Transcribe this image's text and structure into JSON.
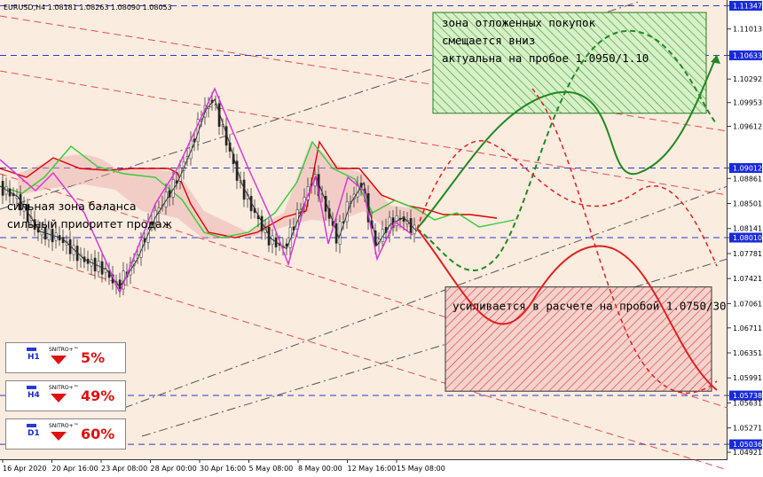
{
  "chart_data": {
    "type": "line",
    "title": "EURUSD,H4 1.08181 1.08263 1.08090 1.08053",
    "xlabel": "",
    "ylabel": "",
    "ylim": [
      1.0482,
      1.1143
    ],
    "grid": false,
    "x_ticks": [
      "16 Apr 2020",
      "20 Apr 16:00",
      "23 Apr 08:00",
      "28 Apr 00:00",
      "30 Apr 16:00",
      "5 May 08:00",
      "8 May 00:00",
      "12 May 16:00",
      "15 May 08:00"
    ],
    "y_ticks": [
      "1.11347",
      "1.11013",
      "1.10633",
      "1.10292",
      "1.09953",
      "1.09612",
      "1.09012",
      "1.08861",
      "1.08501",
      "1.08141",
      "1.08010",
      "1.07781",
      "1.07421",
      "1.07061",
      "1.06711",
      "1.06351",
      "1.05991",
      "1.05738",
      "1.05631",
      "1.05271",
      "1.05036",
      "1.04921"
    ],
    "highlighted_levels": [
      "1.11347",
      "1.10633",
      "1.09012",
      "1.08010",
      "1.05738",
      "1.05036"
    ],
    "price_path": [
      [
        0,
        1.0875
      ],
      [
        20,
        1.086
      ],
      [
        45,
        1.081
      ],
      [
        70,
        1.08
      ],
      [
        95,
        1.077
      ],
      [
        120,
        1.0755
      ],
      [
        135,
        1.073
      ],
      [
        155,
        1.077
      ],
      [
        175,
        1.083
      ],
      [
        200,
        1.088
      ],
      [
        220,
        1.094
      ],
      [
        232,
        1.0985
      ],
      [
        242,
        1.1
      ],
      [
        258,
        1.094
      ],
      [
        272,
        1.088
      ],
      [
        288,
        1.084
      ],
      [
        305,
        1.08
      ],
      [
        323,
        1.0785
      ],
      [
        340,
        1.084
      ],
      [
        356,
        1.089
      ],
      [
        368,
        1.085
      ],
      [
        382,
        1.08
      ],
      [
        395,
        1.085
      ],
      [
        410,
        1.088
      ],
      [
        425,
        1.079
      ],
      [
        440,
        1.082
      ],
      [
        455,
        1.083
      ],
      [
        470,
        1.081
      ]
    ],
    "zones": [
      {
        "label_lines": [
          "зона отложенных покупок",
          "смещается вниз",
          "актуальна на пробое 1.0950/1.10"
        ],
        "top": 1.1125,
        "bottom": 1.098,
        "color": "#2f9a2f"
      },
      {
        "label_lines": [
          "усиливается в расчете на пробой 1.0750/30"
        ],
        "top": 1.073,
        "bottom": 1.058,
        "color": "#d23a3a"
      }
    ],
    "annotations": [
      "сильная зона баланса",
      "сильный приоритет продаж"
    ]
  },
  "indicator_panel": {
    "title": "SNITRO+™",
    "rows": [
      {
        "timeframe": "H1",
        "value": "5%"
      },
      {
        "timeframe": "H4",
        "value": "49%"
      },
      {
        "timeframe": "D1",
        "value": "60%"
      }
    ]
  }
}
